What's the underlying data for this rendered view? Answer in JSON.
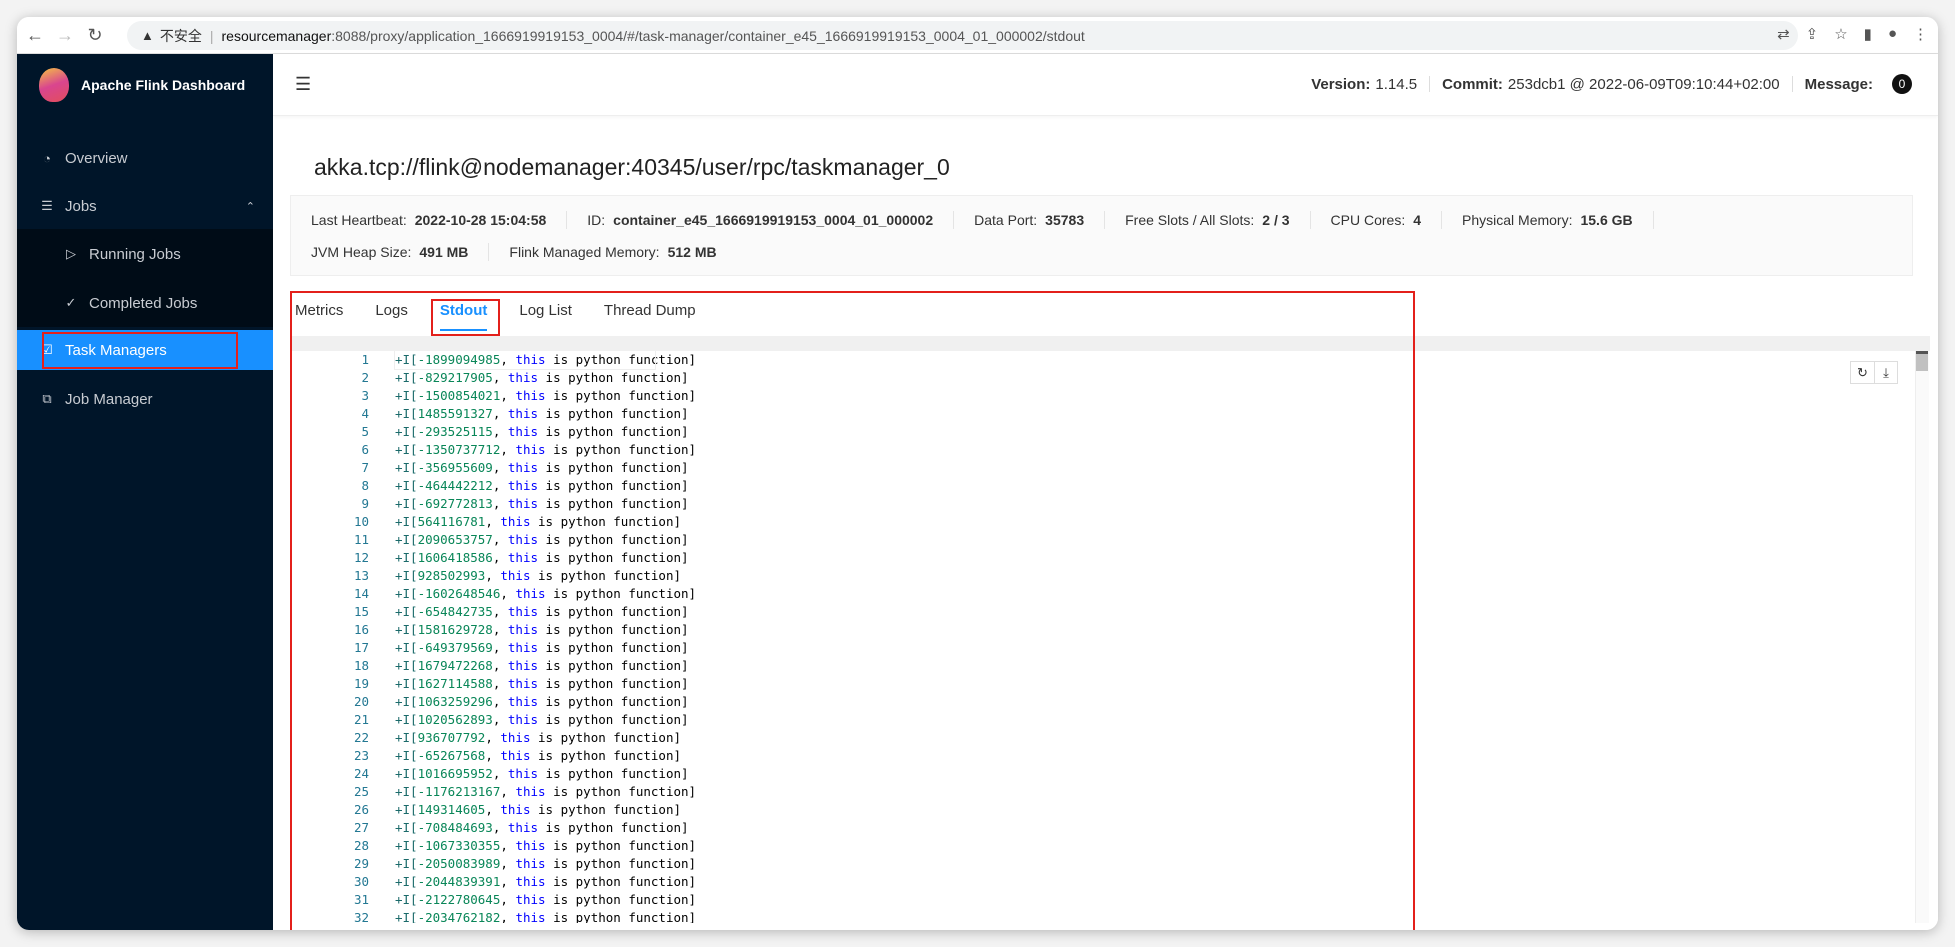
{
  "browser": {
    "security": "不安全",
    "url_host": "resourcemanager",
    "url_rest": ":8088/proxy/application_1666919919153_0004/#/task-manager/container_e45_1666919919153_0004_01_000002/stdout"
  },
  "sidebar": {
    "app_title": "Apache Flink Dashboard",
    "items": [
      {
        "label": "Overview",
        "icon": "dashboard-icon"
      },
      {
        "label": "Jobs",
        "icon": "list-icon"
      },
      {
        "label": "Running Jobs",
        "icon": "play-circle-icon"
      },
      {
        "label": "Completed Jobs",
        "icon": "check-circle-icon"
      },
      {
        "label": "Task Managers",
        "icon": "task-manager-icon",
        "selected": true
      },
      {
        "label": "Job Manager",
        "icon": "cluster-icon"
      }
    ]
  },
  "header": {
    "version_label": "Version:",
    "version": "1.14.5",
    "commit_label": "Commit:",
    "commit": "253dcb1 @ 2022-06-09T09:10:44+02:00",
    "message_label": "Message:",
    "message_count": "0"
  },
  "page": {
    "title": "akka.tcp://flink@nodemanager:40345/user/rpc/taskmanager_0"
  },
  "info": [
    {
      "label": "Last Heartbeat:",
      "value": "2022-10-28 15:04:58"
    },
    {
      "label": "ID:",
      "value": "container_e45_1666919919153_0004_01_000002"
    },
    {
      "label": "Data Port:",
      "value": "35783"
    },
    {
      "label": "Free Slots / All Slots:",
      "value": "2 / 3"
    },
    {
      "label": "CPU Cores:",
      "value": "4"
    },
    {
      "label": "Physical Memory:",
      "value": "15.6 GB"
    },
    {
      "label": "JVM Heap Size:",
      "value": "491 MB"
    },
    {
      "label": "Flink Managed Memory:",
      "value": "512 MB"
    }
  ],
  "tabs": [
    {
      "label": "Metrics"
    },
    {
      "label": "Logs"
    },
    {
      "label": "Stdout",
      "active": true
    },
    {
      "label": "Log List"
    },
    {
      "label": "Thread Dump"
    }
  ],
  "colors": {
    "accent": "#1890ff",
    "sidebar": "#001529",
    "highlight": "#e3201b"
  },
  "stdout": {
    "prefix": "+I[",
    "suffix_kw": "this",
    "suffix": " is python function]",
    "values": [
      "-1899094985",
      "-829217905",
      "-1500854021",
      "1485591327",
      "-293525115",
      "-1350737712",
      "-356955609",
      "-464442212",
      "-692772813",
      "564116781",
      "2090653757",
      "1606418586",
      "928502993",
      "-1602648546",
      "-654842735",
      "1581629728",
      "-649379569",
      "1679472268",
      "1627114588",
      "1063259296",
      "1020562893",
      "936707792",
      "-65267568",
      "1016695952",
      "-1176213167",
      "149314605",
      "-708484693",
      "-1067330355",
      "-2050083989",
      "-2044839391",
      "-2122780645",
      "-2034762182"
    ]
  }
}
